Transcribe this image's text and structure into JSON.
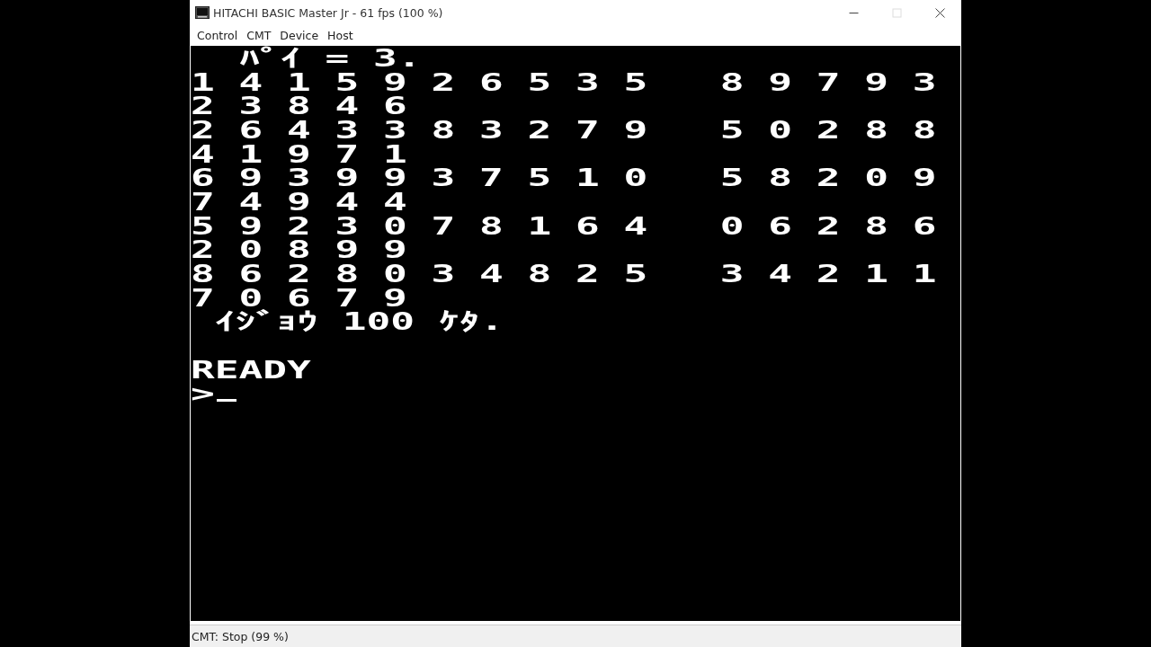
{
  "window": {
    "title": "HITACHI BASIC Master Jr - 61 fps (100 %)",
    "buttons": [
      {
        "kind": "minimize",
        "disabled": false
      },
      {
        "kind": "maximize",
        "disabled": true
      },
      {
        "kind": "close",
        "disabled": false
      }
    ]
  },
  "menu": [
    "Control",
    "CMT",
    "Device",
    "Host"
  ],
  "screen": {
    "lines": [
      {
        "text": "  ﾊﾟｲ = 3."
      },
      {
        "text": "1 4 1 5 9 2 6 5 3 5   8 9 7 9 3"
      },
      {
        "text": "2 3 8 4 6"
      },
      {
        "text": "2 6 4 3 3 8 3 2 7 9   5 0 2 8 8"
      },
      {
        "text": "4 1 9 7 1"
      },
      {
        "text": "6 9 3 9 9 3 7 5 1 0   5 8 2 0 9"
      },
      {
        "text": "7 4 9 4 4"
      },
      {
        "text": "5 9 2 3 0 7 8 1 6 4   0 6 2 8 6"
      },
      {
        "text": "2 0 8 9 9"
      },
      {
        "text": "8 6 2 8 0 3 4 8 2 5   3 4 2 1 1"
      },
      {
        "text": "7 0 6 7 9"
      },
      {
        "text": " ｲｼﾞｮｳ 100 ｹﾀ."
      },
      {
        "text": "READY",
        "blank_line_before": true
      },
      {
        "text": ">"
      }
    ],
    "cursor": true
  },
  "status_bar": "CMT: Stop (99 %)"
}
